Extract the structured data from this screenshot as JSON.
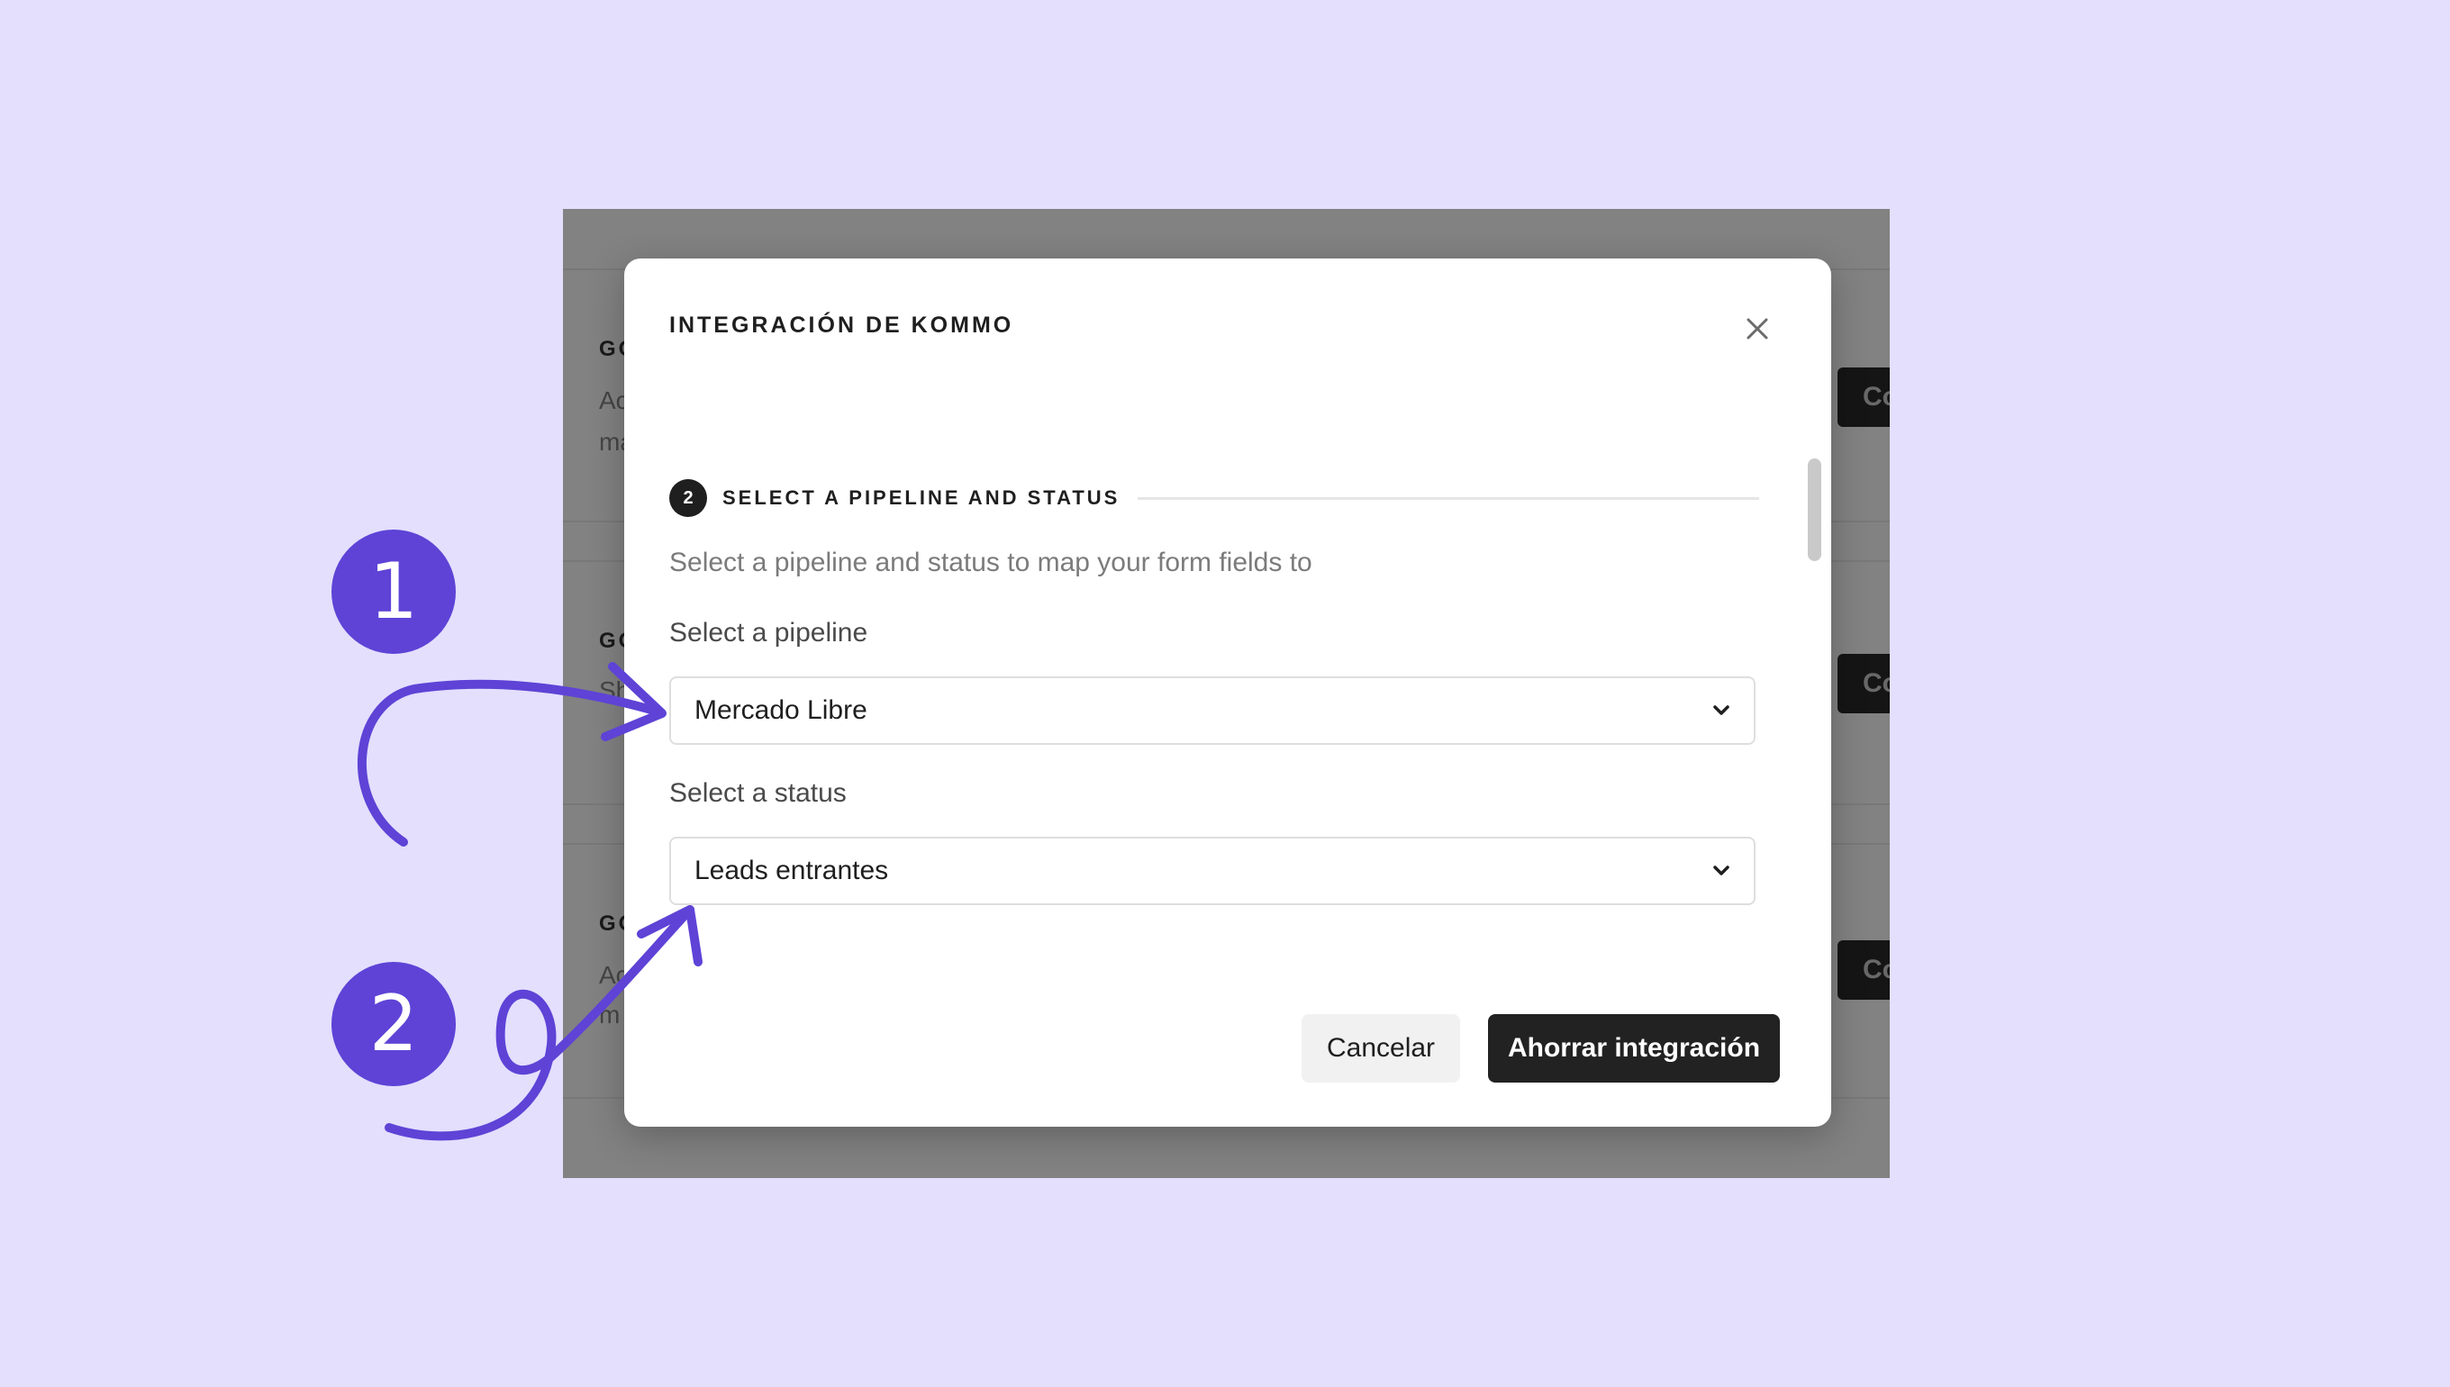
{
  "background_rows": [
    {
      "heading": "GO",
      "line1": "Ac",
      "line2": "ma",
      "button": "Co"
    },
    {
      "heading": "GO",
      "line1": "Sh",
      "line2": "",
      "button": "Co"
    },
    {
      "heading": "GO",
      "line1": "Ac",
      "line2": "m",
      "button": "Co"
    }
  ],
  "modal": {
    "title": "INTEGRACIÓN DE KOMMO",
    "step": {
      "number": "2",
      "label": "SELECT A PIPELINE AND STATUS"
    },
    "description": "Select a pipeline and status to map your form fields to",
    "pipeline": {
      "label": "Select a pipeline",
      "value": "Mercado Libre"
    },
    "status": {
      "label": "Select a status",
      "value": "Leads entrantes"
    },
    "cancel_label": "Cancelar",
    "save_label": "Ahorrar integración"
  },
  "annotations": {
    "badge1": "1",
    "badge2": "2"
  },
  "colors": {
    "page_bg": "#e3dffd",
    "accent_purple": "#5e43d6",
    "primary_button": "#222222"
  }
}
